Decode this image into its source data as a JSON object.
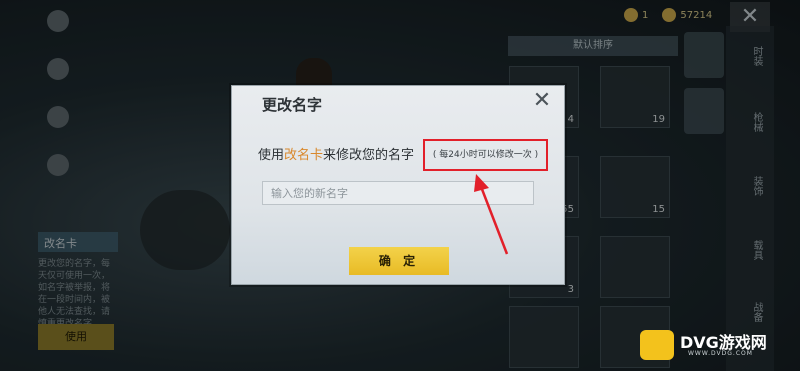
{
  "sidebar": {
    "card_title": "改名卡",
    "description": "更改您的名字，每天仅可使用一次，如名字被举报，将在一段时间内，被他人无法查找，请慎重更改名字",
    "use_label": "使用"
  },
  "currency": {
    "value_a": "1",
    "value_b": "57214"
  },
  "inventory": {
    "sort_label": "默认排序",
    "counts": [
      "4",
      "19",
      "55",
      "15",
      "3"
    ],
    "tabs": [
      "时装",
      "枪械",
      "装饰",
      "载具",
      "战备"
    ]
  },
  "modal": {
    "title": "更改名字",
    "message_prefix": "使用",
    "message_highlight": "改名卡",
    "message_suffix": "来修改您的名字",
    "hint": "( 每24小时可以修改一次 )",
    "input_placeholder": "输入您的新名字",
    "confirm_label": "确 定",
    "close_glyph": "✕"
  },
  "topbar": {
    "close_glyph": "✕"
  },
  "watermark": {
    "brand": "DVG游戏网",
    "url": "WWW.DVDG.COM"
  },
  "colors": {
    "highlight": "#d9882c",
    "callout": "#e2202a",
    "confirm": "#e8bb25"
  }
}
